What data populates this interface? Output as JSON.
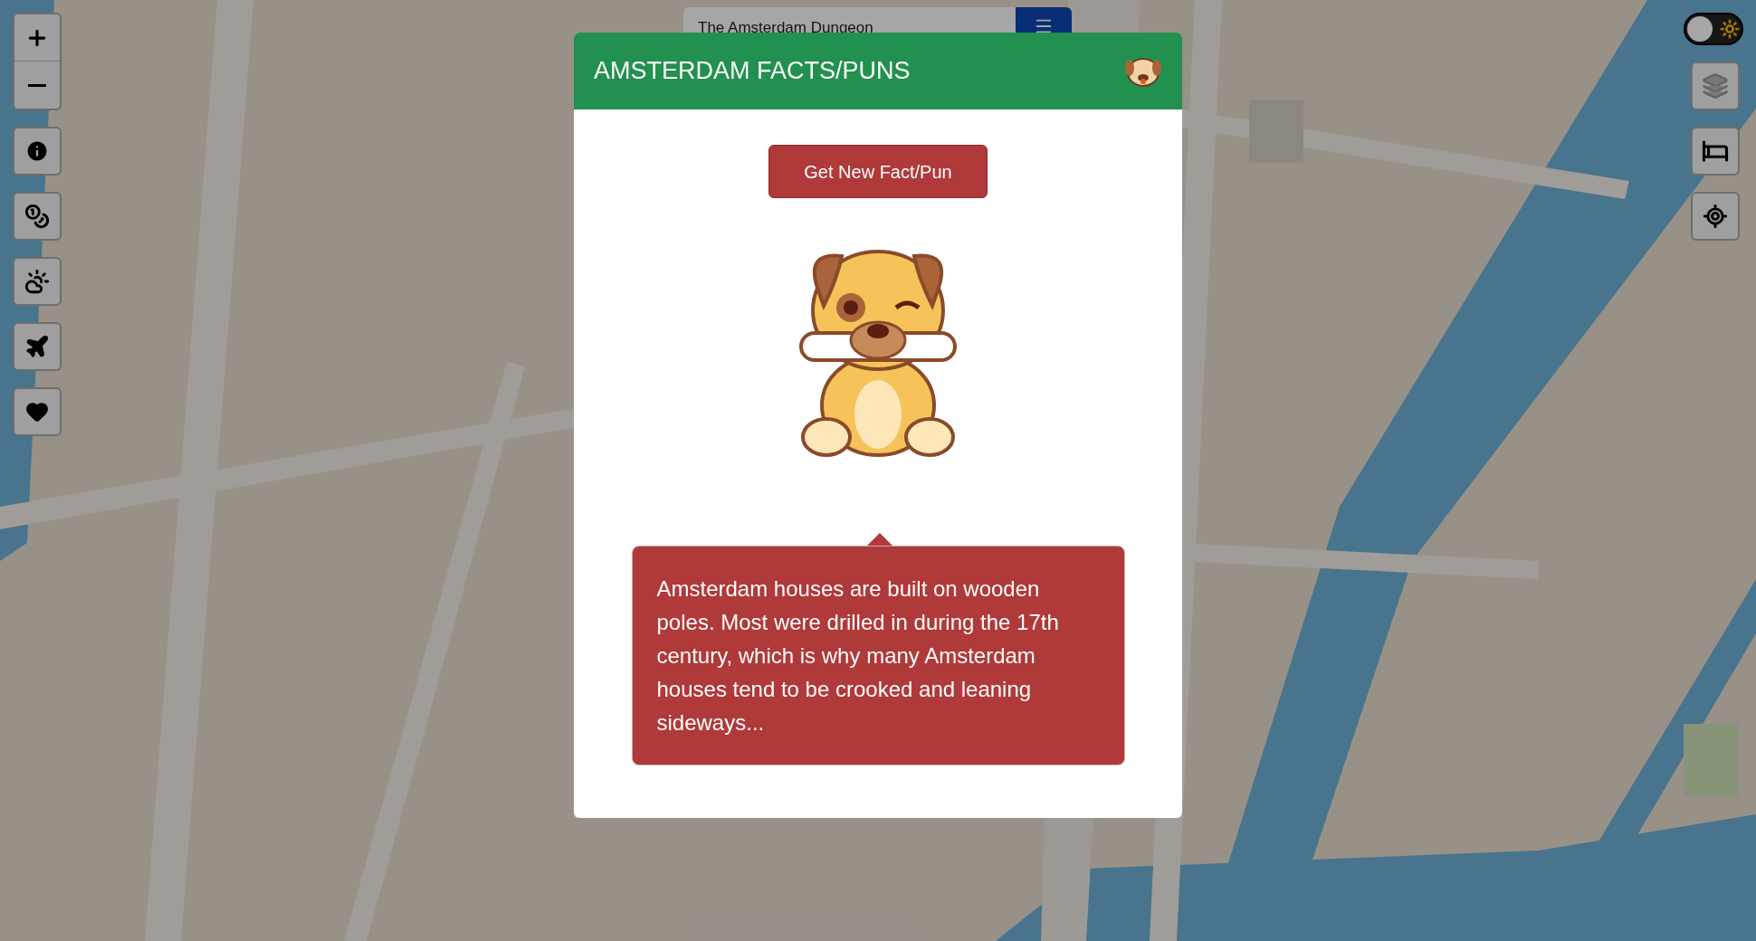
{
  "search": {
    "value": "The Amsterdam Dungeon"
  },
  "theme_toggle": {
    "on": false
  },
  "modal": {
    "title": "AMSTERDAM FACTS/PUNS",
    "button": "Get New Fact/Pun",
    "fact": "Amsterdam houses are built on wooden poles. Most were drilled in during the 17th century, which is why many Amsterdam houses tend to be crooked and leaning sideways..."
  }
}
